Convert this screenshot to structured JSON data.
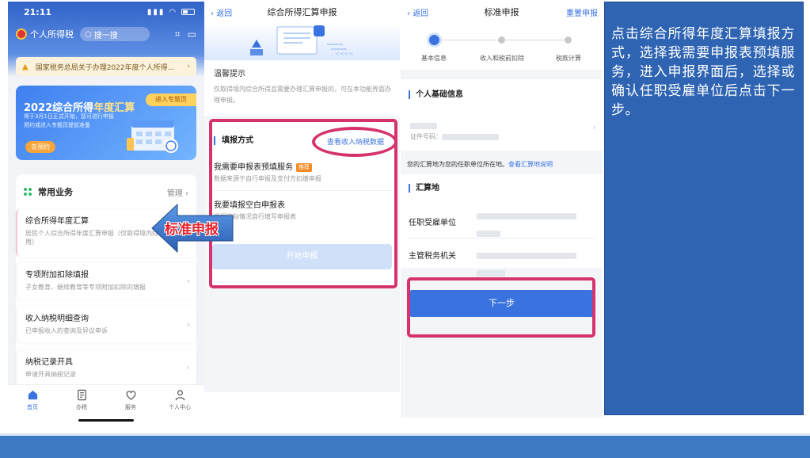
{
  "phone1": {
    "status_time": "21:11",
    "app_name": "个人所得税",
    "search_placeholder": "搜一搜",
    "notice": "国家税务总局关于办理2022年度个人所得...",
    "banner": {
      "title_main": "2022综合所得",
      "title_highlight": "年度汇算",
      "tag": "进入专题页",
      "desc": "将于3月1日正式开始，您可进行申报预约或进入专题页提前准备",
      "button": "去预约"
    },
    "section_title": "常用业务",
    "section_manage": "管理",
    "business_items": [
      {
        "title": "综合所得年度汇算",
        "desc": "居民个人综合所得年度汇算申报（仅取得境内综合所得适用）"
      },
      {
        "title": "专项附加扣除填报",
        "desc": "子女教育、继续教育等专项附加扣除的填报"
      },
      {
        "title": "收入纳税明细查询",
        "desc": "已申报收入的查询及异议申诉"
      },
      {
        "title": "纳税记录开具",
        "desc": "申请开具纳税记录"
      }
    ],
    "tabs": [
      {
        "label": "首页",
        "icon": "home-icon"
      },
      {
        "label": "办税",
        "icon": "document-icon"
      },
      {
        "label": "服务",
        "icon": "heart-icon"
      },
      {
        "label": "个人中心",
        "icon": "user-icon"
      }
    ]
  },
  "arrow_label": "标准申报",
  "phone2": {
    "back": "返回",
    "title": "综合所得汇算申报",
    "tip_title": "温馨提示",
    "tip_desc": "仅取得境内综合所得且需要办理汇算申报的，可在本功能界面办理申报。",
    "method_head": "填报方式",
    "method_link": "查看收入纳税数据",
    "options": [
      {
        "title": "我需要申报表预填服务",
        "badge": "推荐",
        "desc": "数据来源于自行申报及支付方扣缴申报"
      },
      {
        "title": "我要填报空白申报表",
        "desc": "根据实际情况自行填写申报表"
      }
    ],
    "start_button": "开始申报"
  },
  "phone3": {
    "back": "返回",
    "title": "标准申报",
    "reset": "重置申报",
    "steps": [
      "基本信息",
      "收入和税前扣除",
      "税款计算"
    ],
    "personal_head": "个人基础信息",
    "id_label": "证件号码：",
    "location_note": "您的汇算地为您的任职单位所在地。",
    "location_link": "查看汇算地说明",
    "settle_head": "汇算地",
    "row_employer": "任职受雇单位",
    "row_tax_office": "主管税务机关",
    "next_button": "下一步"
  },
  "instruction": "点击综合所得年度汇算填报方式，选择我需要申报表预填服务，进入申报界面后，选择或确认任职受雇单位后点击下一步。",
  "colors": {
    "accent_blue": "#3a72e0",
    "highlight": "#d6336c",
    "instruction_bg": "#2f64b3",
    "bottom_bar": "#3d7ac3"
  }
}
